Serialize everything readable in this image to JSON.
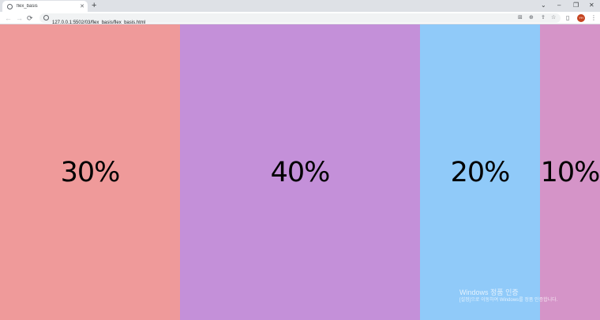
{
  "browser": {
    "tab": {
      "title": "flex_basis",
      "close_icon": "close-icon"
    },
    "new_tab_symbol": "+",
    "window_controls": {
      "dropdown": "⌄",
      "minimize": "–",
      "restore": "❐",
      "close": "✕"
    },
    "nav": {
      "back": "←",
      "forward": "→",
      "reload": "⟳"
    },
    "url": "127.0.0.1:5502/03/flex_basis/flex_basis.html",
    "avatar_initials": "YH",
    "avatar_color": "#c5431f"
  },
  "flex_items": [
    {
      "label": "30%",
      "basis": 0.3,
      "color": "#ef9a9a"
    },
    {
      "label": "40%",
      "basis": 0.4,
      "color": "#c490d9"
    },
    {
      "label": "20%",
      "basis": 0.2,
      "color": "#90caf9"
    },
    {
      "label": "10%",
      "basis": 0.1,
      "color": "#d594c8"
    }
  ],
  "watermark": {
    "title": "Windows 정품 인증",
    "subtitle": "[설정]으로 이동하여 Windows를 정품 인증합니다."
  }
}
